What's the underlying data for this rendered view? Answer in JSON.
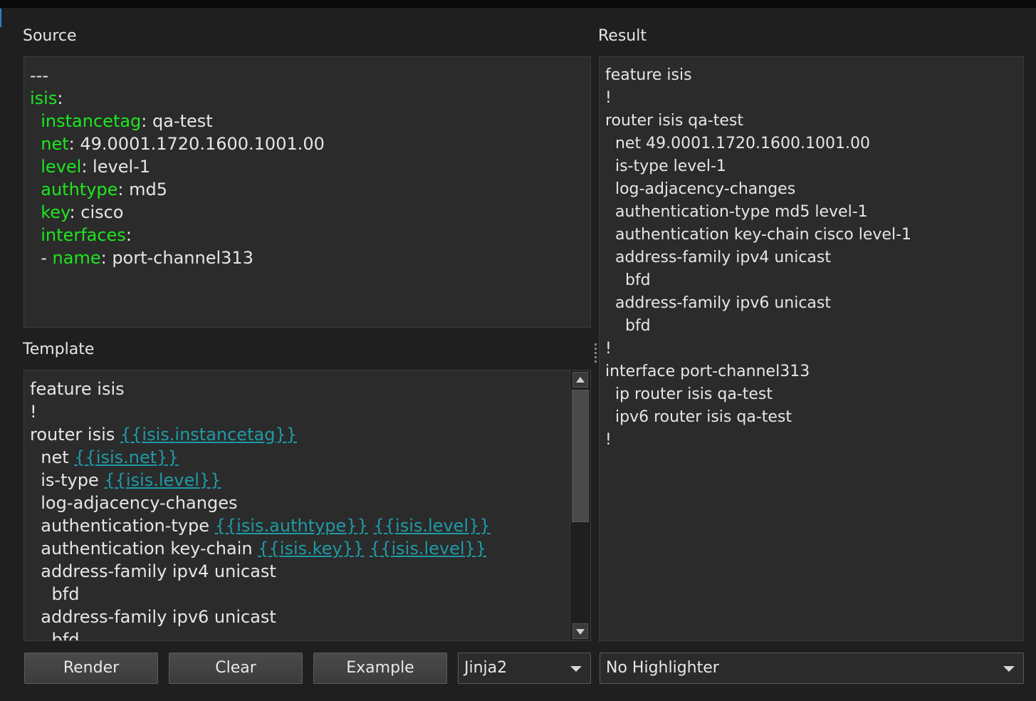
{
  "source": {
    "label": "Source",
    "lines": [
      [
        {
          "t": "---",
          "c": "text"
        }
      ],
      [
        {
          "t": "isis",
          "c": "key"
        },
        {
          "t": ":",
          "c": "text"
        }
      ],
      [
        {
          "t": "  ",
          "c": "text"
        },
        {
          "t": "instancetag",
          "c": "key"
        },
        {
          "t": ": qa-test",
          "c": "text"
        }
      ],
      [
        {
          "t": "  ",
          "c": "text"
        },
        {
          "t": "net",
          "c": "key"
        },
        {
          "t": ": 49.0001.1720.1600.1001.00",
          "c": "text"
        }
      ],
      [
        {
          "t": "  ",
          "c": "text"
        },
        {
          "t": "level",
          "c": "key"
        },
        {
          "t": ": level-1",
          "c": "text"
        }
      ],
      [
        {
          "t": "  ",
          "c": "text"
        },
        {
          "t": "authtype",
          "c": "key"
        },
        {
          "t": ": md5",
          "c": "text"
        }
      ],
      [
        {
          "t": "  ",
          "c": "text"
        },
        {
          "t": "key",
          "c": "key"
        },
        {
          "t": ": cisco",
          "c": "text"
        }
      ],
      [
        {
          "t": "  ",
          "c": "text"
        },
        {
          "t": "interfaces",
          "c": "key"
        },
        {
          "t": ":",
          "c": "text"
        }
      ],
      [
        {
          "t": "  - ",
          "c": "text"
        },
        {
          "t": "name",
          "c": "key"
        },
        {
          "t": ": port-channel313",
          "c": "text"
        }
      ]
    ]
  },
  "template": {
    "label": "Template",
    "lines": [
      [
        {
          "t": "feature isis",
          "c": "text"
        }
      ],
      [
        {
          "t": "!",
          "c": "text"
        }
      ],
      [
        {
          "t": "router isis ",
          "c": "text"
        },
        {
          "t": "{{isis.instancetag}}",
          "c": "tpl"
        }
      ],
      [
        {
          "t": "  net ",
          "c": "text"
        },
        {
          "t": "{{isis.net}}",
          "c": "tpl"
        }
      ],
      [
        {
          "t": "  is-type ",
          "c": "text"
        },
        {
          "t": "{{isis.level}}",
          "c": "tpl"
        }
      ],
      [
        {
          "t": "  log-adjacency-changes",
          "c": "text"
        }
      ],
      [
        {
          "t": "  authentication-type ",
          "c": "text"
        },
        {
          "t": "{{isis.authtype}}",
          "c": "tpl"
        },
        {
          "t": " ",
          "c": "text"
        },
        {
          "t": "{{isis.level}}",
          "c": "tpl"
        }
      ],
      [
        {
          "t": "  authentication key-chain ",
          "c": "text"
        },
        {
          "t": "{{isis.key}}",
          "c": "tpl"
        },
        {
          "t": " ",
          "c": "text"
        },
        {
          "t": "{{isis.level}}",
          "c": "tpl"
        }
      ],
      [
        {
          "t": "  address-family ipv4 unicast",
          "c": "text"
        }
      ],
      [
        {
          "t": "    bfd",
          "c": "text"
        }
      ],
      [
        {
          "t": "  address-family ipv6 unicast",
          "c": "text"
        }
      ],
      [
        {
          "t": "    bfd",
          "c": "text"
        }
      ]
    ]
  },
  "result": {
    "label": "Result",
    "lines": [
      "feature isis",
      "!",
      "router isis qa-test",
      "  net 49.0001.1720.1600.1001.00",
      "  is-type level-1",
      "  log-adjacency-changes",
      "  authentication-type md5 level-1",
      "  authentication key-chain cisco level-1",
      "  address-family ipv4 unicast",
      "    bfd",
      "  address-family ipv6 unicast",
      "    bfd",
      "!",
      "interface port-channel313",
      "  ip router isis qa-test",
      "  ipv6 router isis qa-test",
      "!"
    ]
  },
  "buttons": {
    "render": "Render",
    "clear": "Clear",
    "example": "Example"
  },
  "engine_select": {
    "selected": "Jinja2"
  },
  "highlighter_select": {
    "selected": "No Highlighter"
  },
  "icons": {
    "scroll_up": "triangle-up",
    "scroll_down": "triangle-down",
    "dropdown": "triangle-down"
  },
  "colors": {
    "yaml_key": "#1ee61e",
    "template_var": "#1e9aa6",
    "background": "#1f1f1f",
    "pane": "#2b2b2b"
  }
}
